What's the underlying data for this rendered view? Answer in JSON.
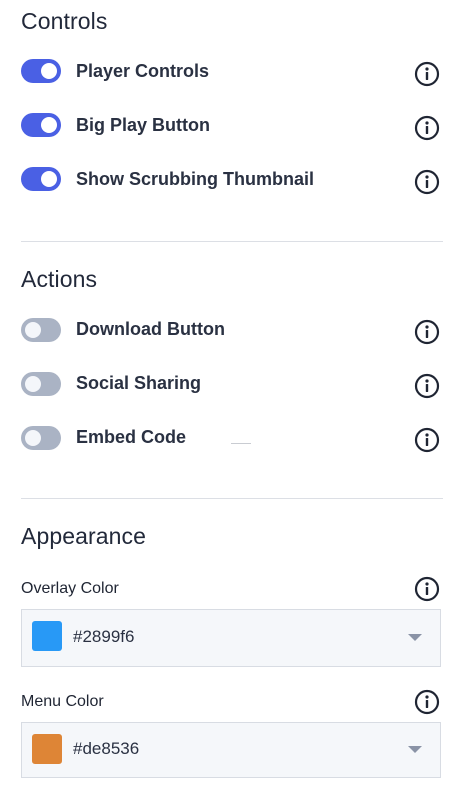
{
  "controls": {
    "title": "Controls",
    "items": [
      {
        "label": "Player Controls",
        "enabled": true
      },
      {
        "label": "Big Play Button",
        "enabled": true
      },
      {
        "label": "Show Scrubbing Thumbnail",
        "enabled": true
      }
    ]
  },
  "actions": {
    "title": "Actions",
    "items": [
      {
        "label": "Download Button",
        "enabled": false
      },
      {
        "label": "Social Sharing",
        "enabled": false
      },
      {
        "label": "Embed Code",
        "enabled": false
      }
    ]
  },
  "appearance": {
    "title": "Appearance",
    "overlay": {
      "label": "Overlay Color",
      "value": "#2899f6",
      "swatch": "#2899f6"
    },
    "menu": {
      "label": "Menu Color",
      "value": "#de8536",
      "swatch": "#de8536"
    }
  },
  "colors": {
    "toggle_on": "#4a60e4",
    "toggle_off": "#aab3c4",
    "icon": "#1f2533"
  }
}
